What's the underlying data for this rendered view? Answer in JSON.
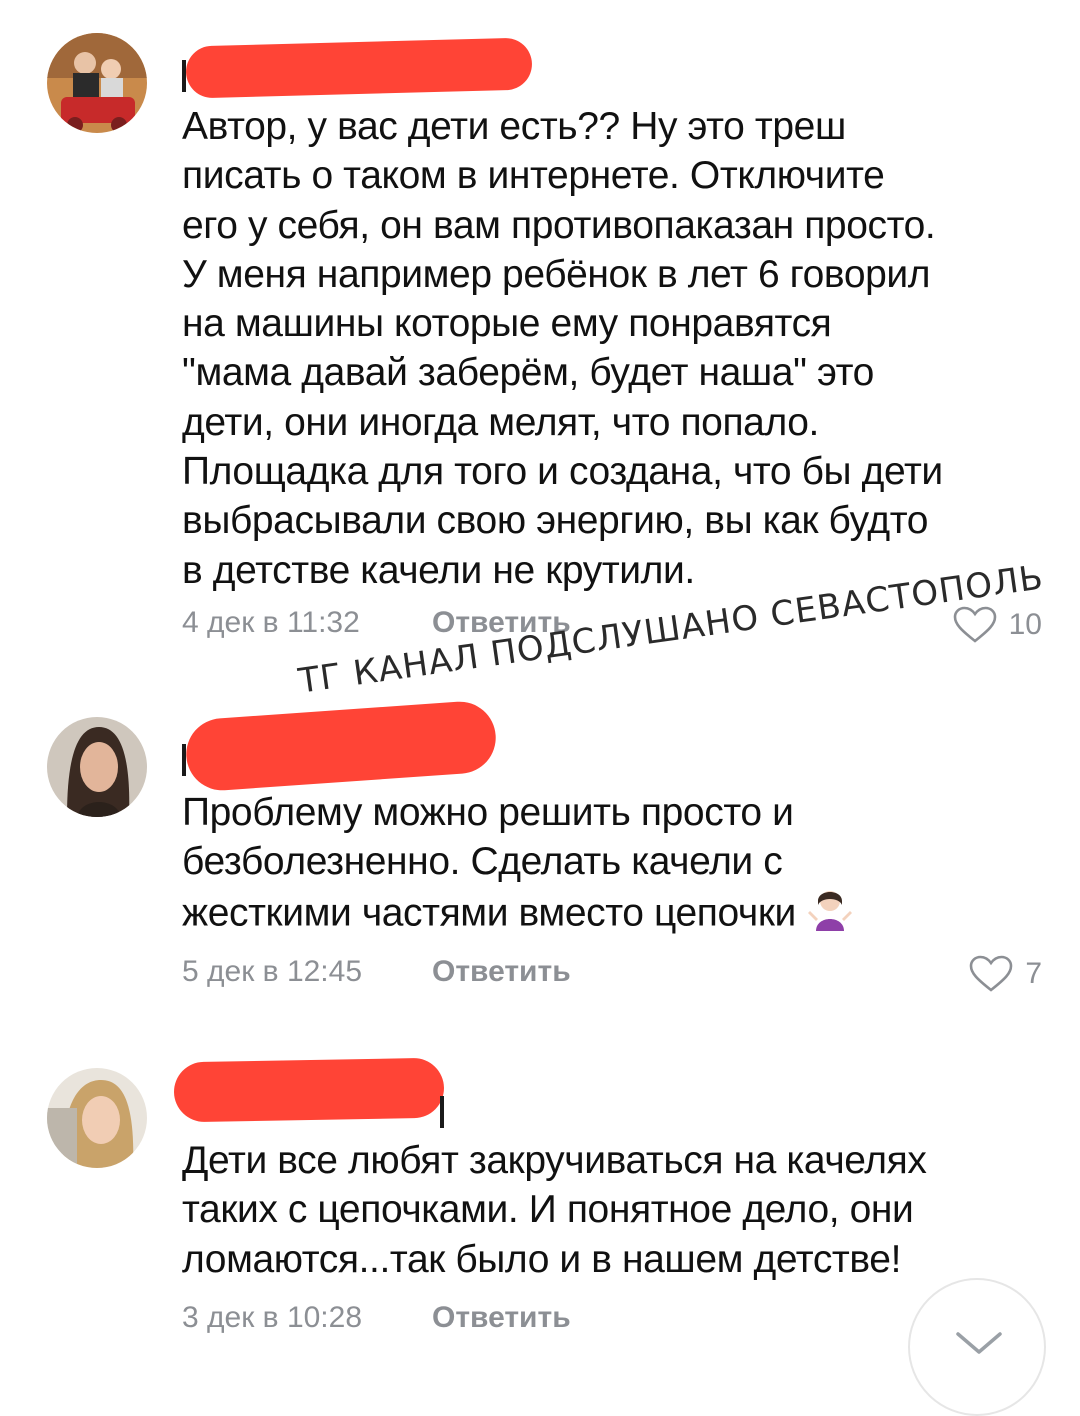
{
  "colors": {
    "meta_gray": "#8c8f94",
    "redaction_red": "#ff4436",
    "text": "#111111"
  },
  "comments": [
    {
      "lines": [
        "Автор, у вас дети есть?? Ну это треш",
        "писать о таком в интернете. Отключите",
        "его у себя, он вам противопаказан просто.",
        "У меня например ребёнок в лет 6 говорил",
        "на машины которые ему понравятся",
        "\"мама давай заберём, будет наша\" это",
        "дети, они иногда мелят, что попало.",
        "Площадка для того и создана,  что бы дети",
        "выбрасывали свою энергию, вы как будто",
        "в детстве качели не крутили."
      ],
      "date": "4 дек в 11:32",
      "reply": "Ответить",
      "likes": "10"
    },
    {
      "lines": [
        "Проблему можно решить просто и",
        "безболезненно. Сделать качели с",
        "жесткими частями вместо цепочки"
      ],
      "date": "5 дек в 12:45",
      "reply": "Ответить",
      "likes": "7"
    },
    {
      "lines": [
        "Дети все любят закручиваться на качелях",
        "таких с цепочками. И понятное дело, они",
        "ломаются...так было и в нашем детстве!"
      ],
      "date": "3 дек в 10:28",
      "reply": "Ответить",
      "likes": ""
    }
  ],
  "watermark": "ТГ КАНАЛ ПОДСЛУШАНО СЕВАСТОПОЛЬ",
  "icons": {
    "like": "heart-outline-icon",
    "scroll": "chevron-down-icon",
    "emoji": "person-shrugging-emoji"
  }
}
